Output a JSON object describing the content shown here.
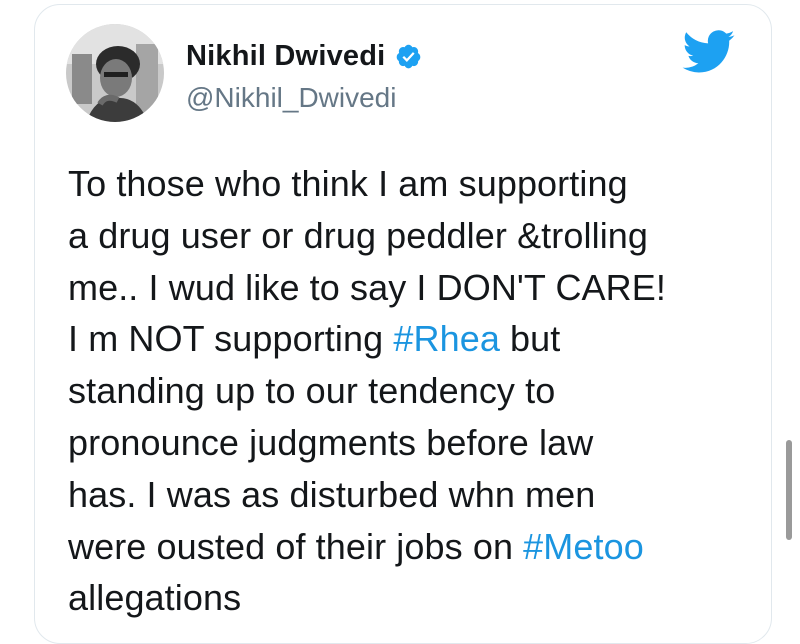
{
  "user": {
    "display_name": "Nikhil Dwivedi",
    "handle": "@Nikhil_Dwivedi",
    "verified": true,
    "avatar_icon": "profile-photo"
  },
  "platform": {
    "logo_icon": "twitter-bird-icon",
    "accent": "#1da1f2"
  },
  "tweet": {
    "lines": [
      [
        {
          "text": "To those who think I am supporting",
          "type": "text"
        }
      ],
      [
        {
          "text": "a drug user or drug peddler &trolling",
          "type": "text"
        }
      ],
      [
        {
          "text": "me.. I wud like to say I DON'T CARE!",
          "type": "text"
        }
      ],
      [
        {
          "text": "I m NOT supporting ",
          "type": "text"
        },
        {
          "text": "#Rhea",
          "type": "hashtag"
        },
        {
          "text": " but",
          "type": "text"
        }
      ],
      [
        {
          "text": "standing up to our tendency to",
          "type": "text"
        }
      ],
      [
        {
          "text": "pronounce judgments before law",
          "type": "text"
        }
      ],
      [
        {
          "text": "has. I was as disturbed whn men",
          "type": "text"
        }
      ],
      [
        {
          "text": "were ousted of their jobs on ",
          "type": "text"
        },
        {
          "text": "#Metoo",
          "type": "hashtag"
        }
      ],
      [
        {
          "text": "allegations",
          "type": "text"
        }
      ]
    ]
  },
  "colors": {
    "text": "#14171a",
    "secondary": "#657786",
    "link": "#1b95e0",
    "border": "#e1e8ed"
  }
}
